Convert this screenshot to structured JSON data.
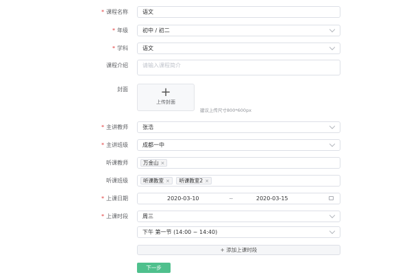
{
  "form": {
    "course_name": {
      "label": "课程名称",
      "value": "语文"
    },
    "grade": {
      "label": "年级",
      "value": "初中 / 初二"
    },
    "subject": {
      "label": "学科",
      "value": "语文"
    },
    "intro": {
      "label": "课程介绍",
      "placeholder": "请输入课程简介"
    },
    "cover": {
      "label": "封面",
      "upload_label": "上传封面",
      "plus": "+",
      "hint": "建议上传尺寸800*600px"
    },
    "teacher": {
      "label": "主讲教师",
      "value": "张浩"
    },
    "class": {
      "label": "主讲班级",
      "value": "成都一中"
    },
    "listen_teacher": {
      "label": "听课教师",
      "tags": [
        "万金山"
      ]
    },
    "listen_class": {
      "label": "听课班级",
      "tags": [
        "听课教室",
        "听课教室2"
      ]
    },
    "date": {
      "label": "上课日期",
      "start": "2020-03-10",
      "sep": "~",
      "end": "2020-03-15"
    },
    "time": {
      "label": "上课时段",
      "weekday": "周三",
      "period": "下午 第一节 (14:00 ~ 14:40)"
    },
    "add_time_label": "+ 添加上课时段",
    "next_label": "下一步",
    "required_mark": "*",
    "tag_close": "×"
  },
  "colors": {
    "accent": "#4fc08d",
    "required": "#e03a3a"
  }
}
